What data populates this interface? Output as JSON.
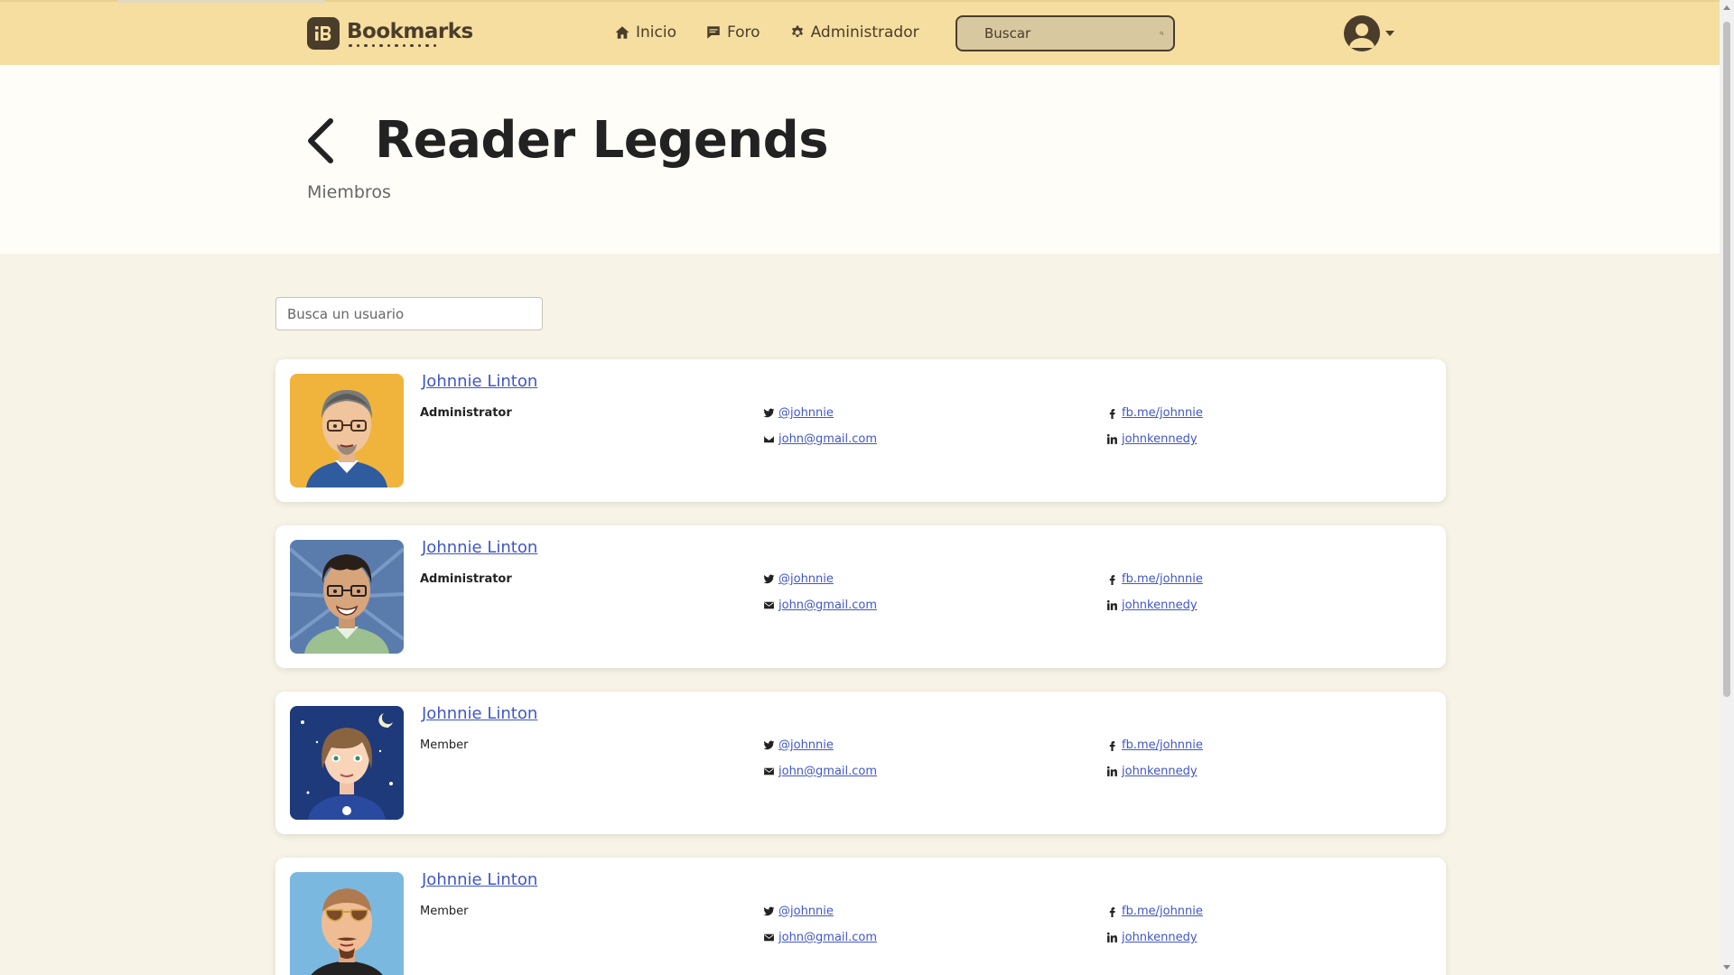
{
  "navbar": {
    "brand": "Bookmarks",
    "links": [
      {
        "label": "Inicio",
        "icon": "home-icon"
      },
      {
        "label": "Foro",
        "icon": "chat-icon"
      },
      {
        "label": "Administrador",
        "icon": "gear-icon"
      }
    ],
    "search_placeholder": "Buscar"
  },
  "header": {
    "title": "Reader Legends",
    "subtitle": "Miembros"
  },
  "user_search": {
    "placeholder": "Busca un usuario"
  },
  "members": [
    {
      "name": "Johnnie Linton",
      "role": "Administrator",
      "twitter": "@johnnie",
      "email": "john@gmail.com",
      "facebook": "fb.me/johnnie",
      "linkedin": "johnkennedy"
    },
    {
      "name": "Johnnie Linton",
      "role": "Administrator",
      "twitter": "@johnnie",
      "email": "john@gmail.com",
      "facebook": "fb.me/johnnie",
      "linkedin": "johnkennedy"
    },
    {
      "name": "Johnnie Linton",
      "role": "Member",
      "twitter": "@johnnie",
      "email": "john@gmail.com",
      "facebook": "fb.me/johnnie",
      "linkedin": "johnkennedy"
    },
    {
      "name": "Johnnie Linton",
      "role": "Member",
      "twitter": "@johnnie",
      "email": "john@gmail.com",
      "facebook": "fb.me/johnnie",
      "linkedin": "johnkennedy"
    }
  ],
  "colors": {
    "navbar_bg": "#f5dea0",
    "brand_dark": "#4a3d2b",
    "link_blue": "#4056c8",
    "page_bg": "#f7f3e7"
  }
}
